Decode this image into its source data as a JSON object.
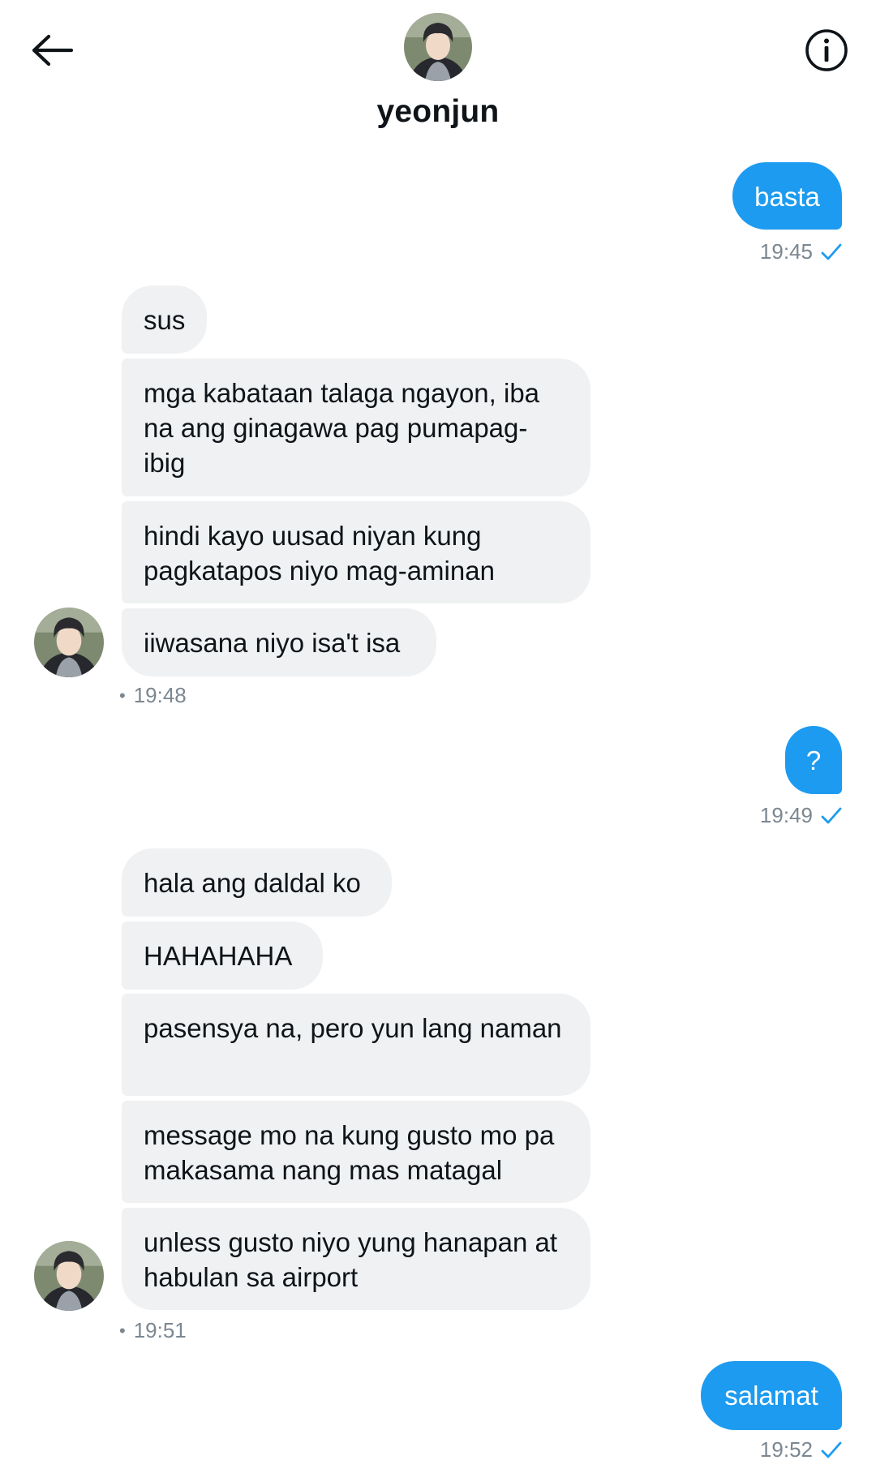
{
  "header": {
    "contact_name": "yeonjun",
    "back_icon": "arrow-left-icon",
    "info_icon": "info-circle-icon"
  },
  "colors": {
    "accent": "#1d9bf0",
    "incoming_bubble": "#eff1f3",
    "timestamp": "#7b8791"
  },
  "messages": {
    "m1": {
      "text": "basta",
      "time": "19:45",
      "status": "sent-check"
    },
    "g1": {
      "b1": "sus",
      "b2": "mga kabataan talaga ngayon, iba na ang ginagawa pag pumapag-ibig",
      "b3": "hindi kayo uusad niyan kung pagkatapos niyo mag-aminan",
      "b4": "iiwasana niyo isa't isa",
      "time": "19:48"
    },
    "m2": {
      "text": "?",
      "time": "19:49"
    },
    "g2": {
      "b1": "hala ang daldal ko",
      "b2": "HAHAHAHA",
      "b3": "pasensya na, pero yun lang naman",
      "b4": "message mo na kung gusto mo pa makasama nang mas matagal",
      "b5": "unless gusto niyo yung hanapan at habulan sa airport",
      "time": "19:51"
    },
    "m3": {
      "text": "salamat",
      "time": "19:52"
    }
  }
}
